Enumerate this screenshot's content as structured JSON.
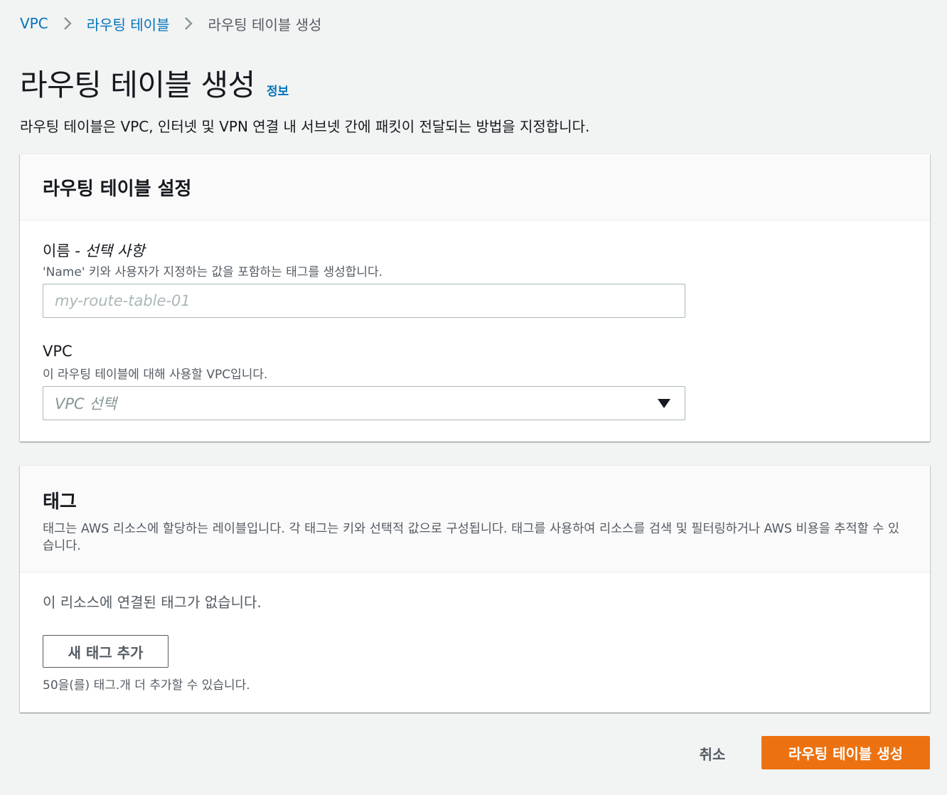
{
  "breadcrumb": {
    "items": [
      "VPC",
      "라우팅 테이블",
      "라우팅 테이블 생성"
    ]
  },
  "header": {
    "title": "라우팅 테이블 생성",
    "info_link": "정보",
    "description": "라우팅 테이블은 VPC, 인터넷 및 VPN 연결 내 서브넷 간에 패킷이 전달되는 방법을 지정합니다."
  },
  "settings": {
    "title": "라우팅 테이블 설정",
    "name_field": {
      "label": "이름 - ",
      "label_optional": "선택 사항",
      "description": "'Name' 키와 사용자가 지정하는 값을 포함하는 태그를 생성합니다.",
      "value": "",
      "placeholder": "my-route-table-01"
    },
    "vpc_field": {
      "label": "VPC",
      "description": "이 라우팅 테이블에 대해 사용할 VPC입니다.",
      "placeholder": "VPC 선택",
      "icon": "caret-down-icon"
    }
  },
  "tags": {
    "title": "태그",
    "description": "태그는 AWS 리소스에 할당하는 레이블입니다. 각 태그는 키와 선택적 값으로 구성됩니다. 태그를 사용하여 리소스를 검색 및 필터링하거나 AWS 비용을 추적할 수 있습니다.",
    "empty_message": "이 리소스에 연결된 태그가 없습니다.",
    "add_button": "새 태그 추가",
    "limit_text": "50을(를) 태그.개 더 추가할 수 있습니다."
  },
  "footer": {
    "cancel_label": "취소",
    "submit_label": "라우팅 테이블 생성"
  },
  "colors": {
    "link": "#0073bb",
    "primary": "#ec7211",
    "background": "#f2f3f3"
  }
}
